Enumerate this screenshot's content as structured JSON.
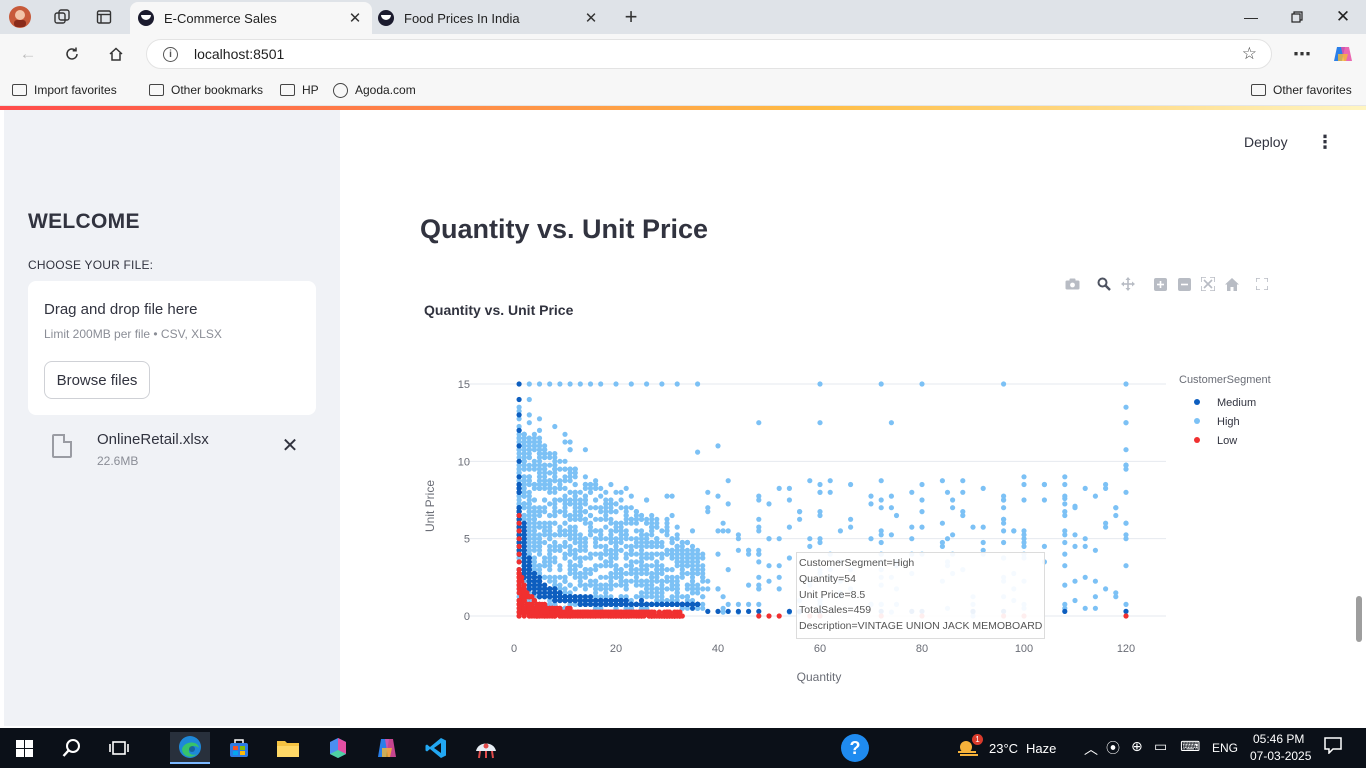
{
  "browser": {
    "tabs": [
      {
        "title": "E-Commerce Sales",
        "active": true
      },
      {
        "title": "Food Prices In India",
        "active": false
      }
    ],
    "address": "localhost:8501",
    "favorites": [
      {
        "label": "Import favorites",
        "icon": "import-icon"
      },
      {
        "label": "Other bookmarks",
        "icon": "folder-icon"
      },
      {
        "label": "HP",
        "icon": "folder-icon"
      },
      {
        "label": "Agoda.com",
        "icon": "globe-icon"
      }
    ],
    "other_favorites": "Other favorites"
  },
  "sidebar": {
    "title": "WELCOME",
    "choose_label": "CHOOSE YOUR FILE:",
    "dropzone_title": "Drag and drop file here",
    "dropzone_limit": "Limit 200MB per file • CSV, XLSX",
    "browse_label": "Browse files",
    "file_name": "OnlineRetail.xlsx",
    "file_size": "22.6MB"
  },
  "header": {
    "deploy_label": "Deploy",
    "menu_icon": "kebab-menu-icon"
  },
  "main": {
    "title": "Quantity vs. Unit Price"
  },
  "chart_data": {
    "type": "scatter",
    "title": "Quantity vs. Unit Price",
    "xlabel": "Quantity",
    "ylabel": "Unit Price",
    "xlim": [
      0,
      120
    ],
    "ylim": [
      0,
      15
    ],
    "x_ticks": [
      "0",
      "20",
      "40",
      "60",
      "80",
      "100",
      "120"
    ],
    "y_ticks": [
      "0",
      "5",
      "10",
      "15"
    ],
    "grid": "horizontal",
    "legend_title": "CustomerSegment",
    "legend_position": "right",
    "series": [
      {
        "name": "Medium",
        "color": "#0d5ebf"
      },
      {
        "name": "High",
        "color": "#7cc1f5"
      },
      {
        "name": "Low",
        "color": "#f03030"
      }
    ],
    "hover": {
      "lines": [
        "CustomerSegment=High",
        "Quantity=54",
        "Unit Price=8.5",
        "TotalSales=459",
        "Description=VINTAGE UNION JACK MEMOBOARD"
      ]
    },
    "modebar_icons": [
      "camera-icon",
      "zoom-icon",
      "pan-icon",
      "zoom-in-icon",
      "zoom-out-icon",
      "autoscale-icon",
      "reset-icon",
      "fullscreen-icon"
    ]
  },
  "taskbar": {
    "weather_temp": "23°C",
    "weather_desc": "Haze",
    "weather_badge": "1",
    "language": "ENG",
    "time": "05:46 PM",
    "date": "07-03-2025"
  }
}
